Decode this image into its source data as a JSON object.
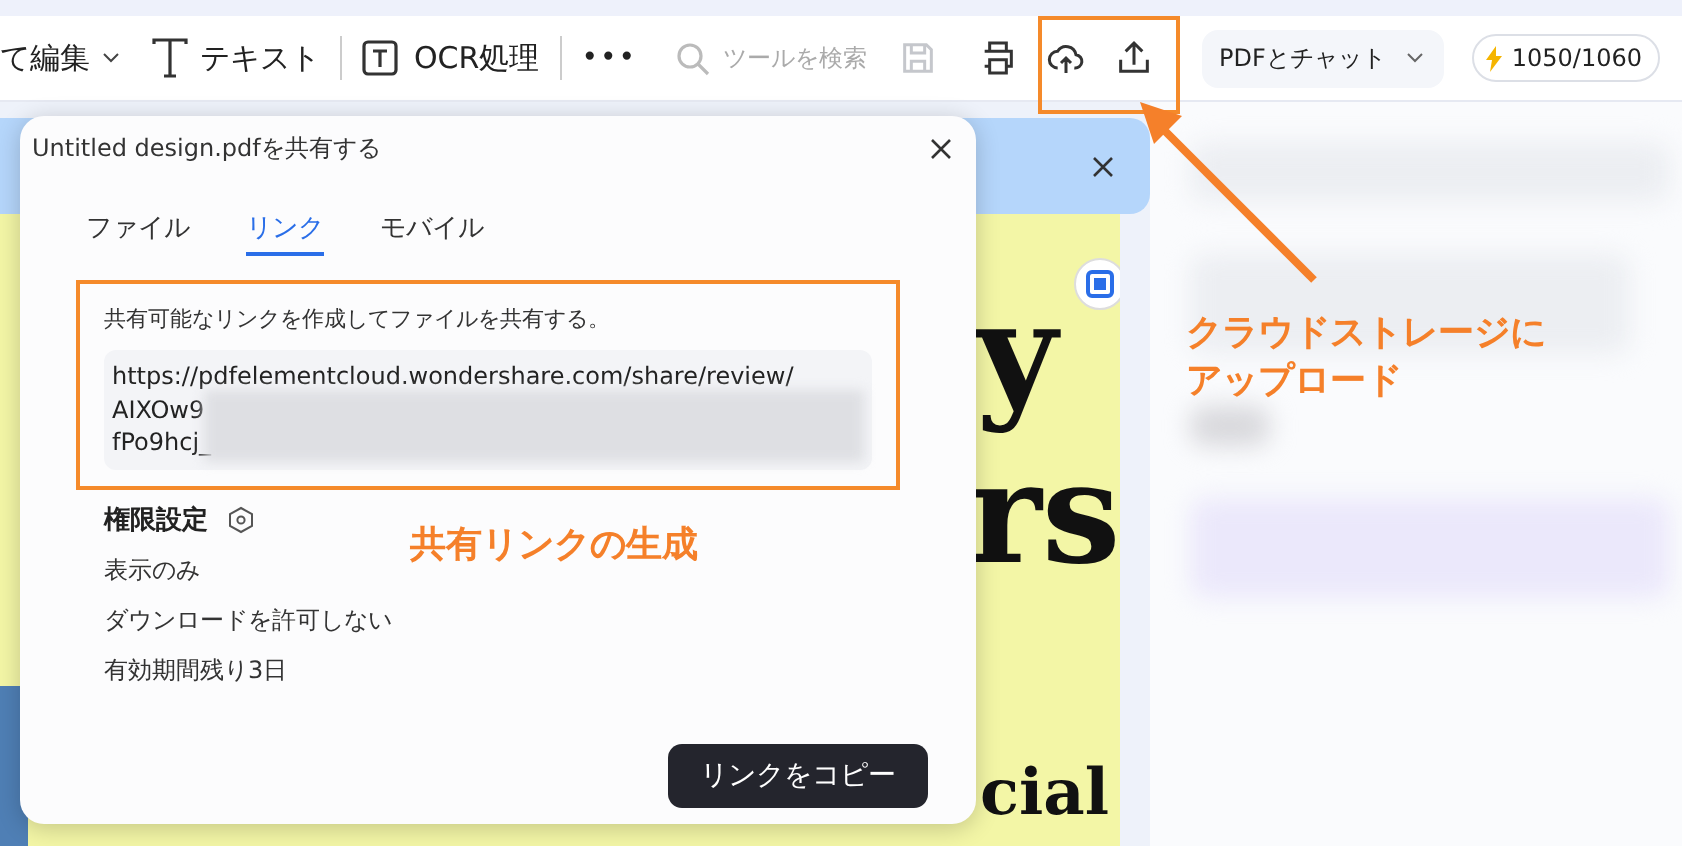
{
  "toolbar": {
    "items": [
      {
        "kind": "dropdown",
        "label": "て編集"
      },
      {
        "kind": "text-tool",
        "label": "テキスト"
      },
      {
        "kind": "divider"
      },
      {
        "kind": "ocr",
        "label": "OCR処理"
      },
      {
        "kind": "divider"
      },
      {
        "kind": "more",
        "label": "•••"
      },
      {
        "kind": "search",
        "placeholder": "ツールを検索"
      },
      {
        "kind": "save",
        "disabled": true
      },
      {
        "kind": "print",
        "disabled": false
      },
      {
        "kind": "cloud",
        "disabled": false
      },
      {
        "kind": "share",
        "disabled": false
      }
    ],
    "chat": {
      "label": "PDFとチャット"
    },
    "credits": {
      "label": "1050/1060"
    }
  },
  "document": {
    "texts": [
      "y",
      "rs",
      "cial"
    ]
  },
  "dialog": {
    "title": "Untitled design.pdfを共有する",
    "tabs": [
      {
        "label": "ファイル",
        "selected": false
      },
      {
        "label": "リンク",
        "selected": true
      },
      {
        "label": "モバイル",
        "selected": false
      }
    ],
    "description": "共有可能なリンクを作成してファイルを共有する。",
    "link_lines": [
      "https://pdfelementcloud.wondershare.com/share/review/",
      "AIXOw9",
      "fPo9hcj_"
    ],
    "permissions": {
      "title": "権限設定",
      "items": [
        "表示のみ",
        "ダウンロードを許可しない",
        "有効期間残り3日"
      ]
    },
    "button": "リンクをコピー"
  },
  "annotations": [
    {
      "kind": "caption-link",
      "text": "共有リンクの生成"
    },
    {
      "kind": "caption-upload",
      "text": "クラウドストレージにアップロード"
    }
  ]
}
